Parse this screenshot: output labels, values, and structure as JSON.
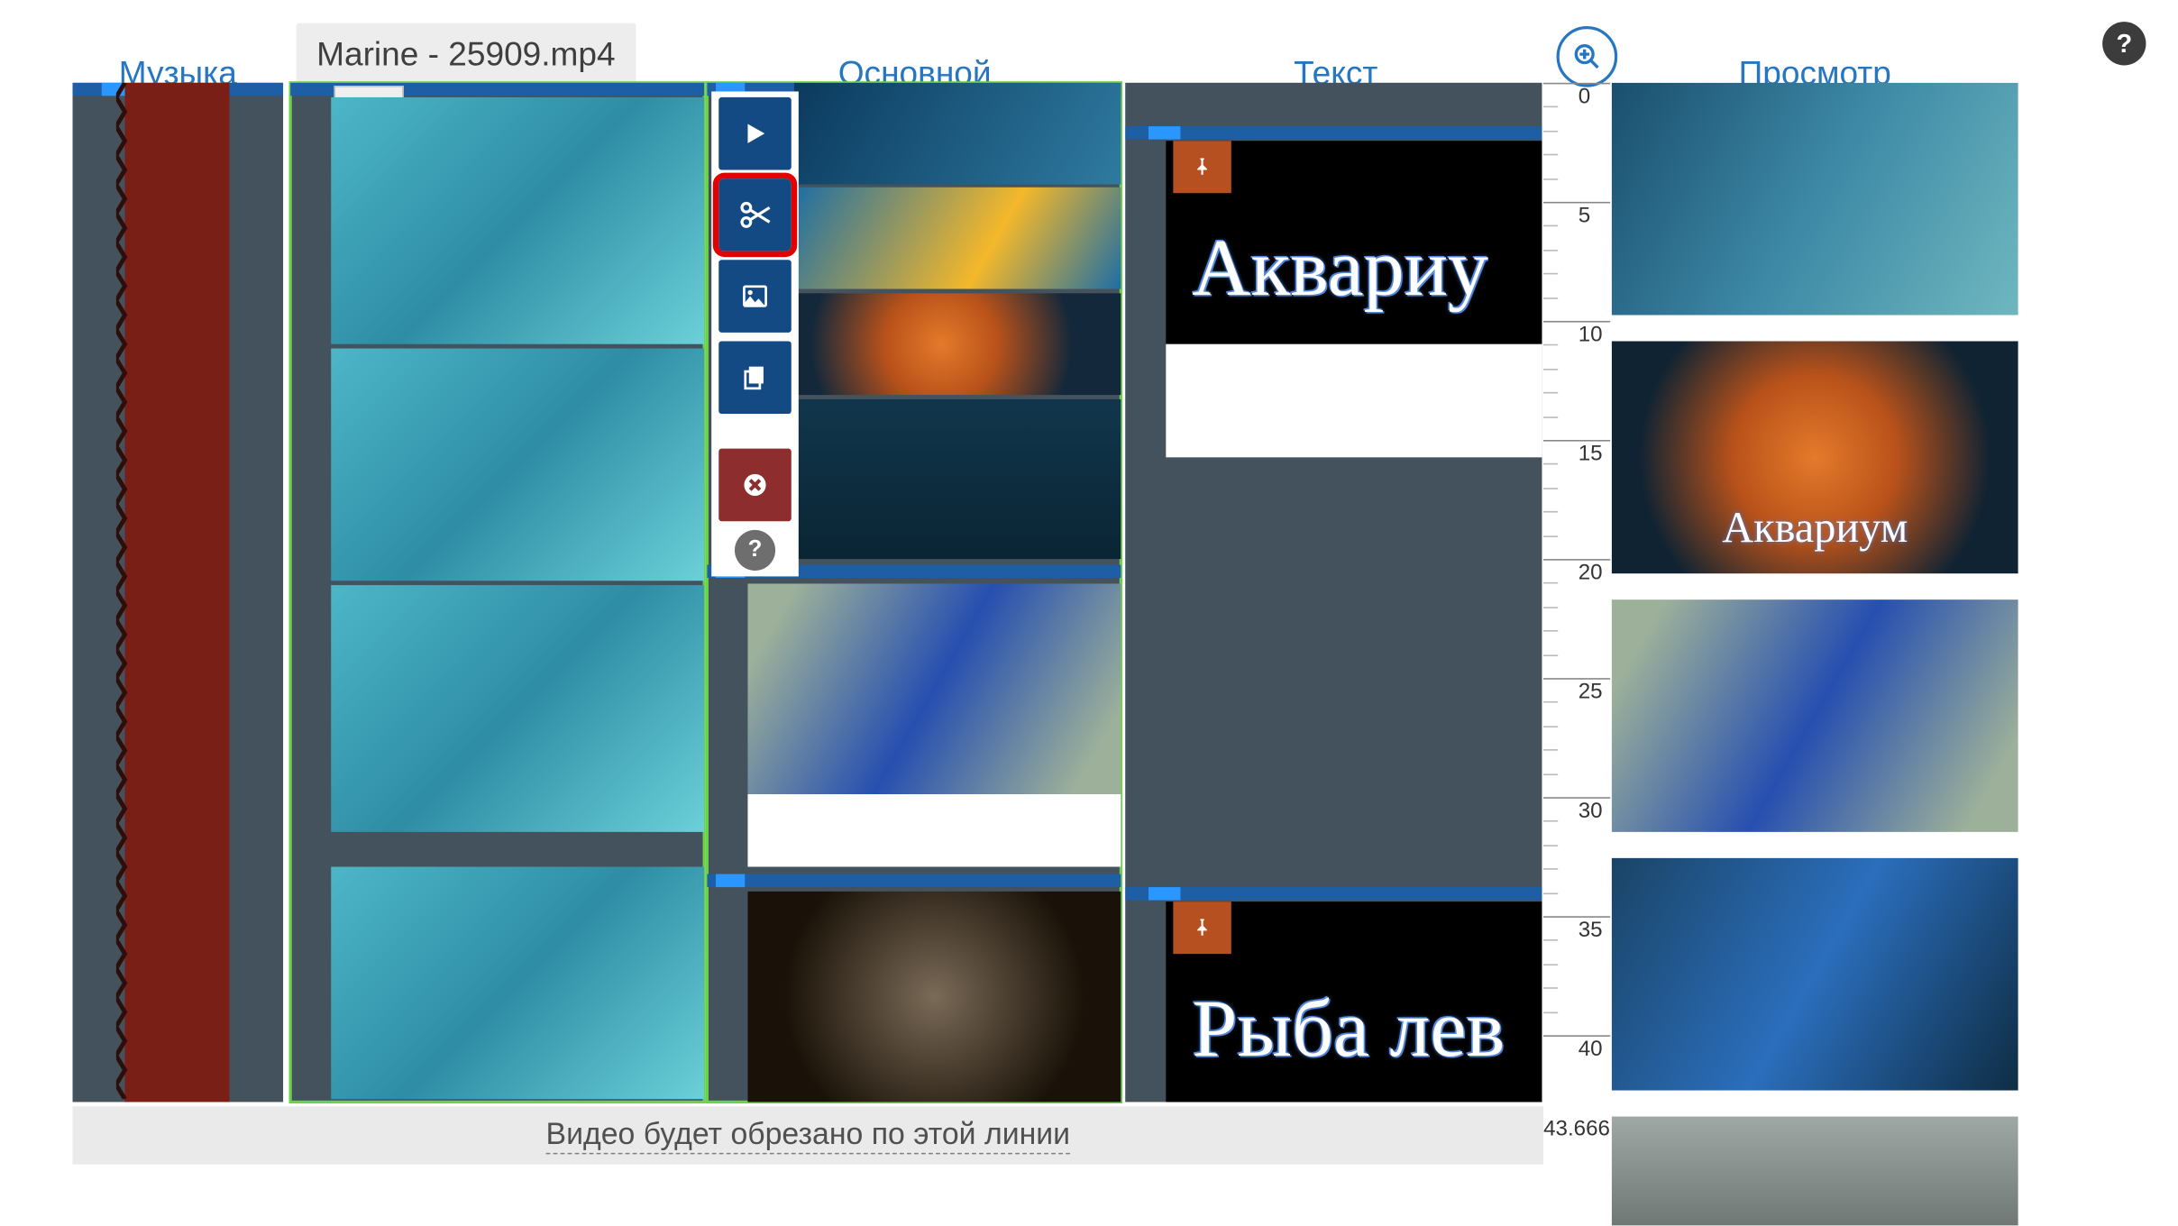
{
  "filename": "Marine - 25909.mp4",
  "tabs": {
    "music": "Музыка",
    "main": "Основной",
    "text": "Текст",
    "preview": "Просмотр"
  },
  "toolbar": {
    "play": "play",
    "cut": "cut",
    "image": "image",
    "copy": "copy",
    "delete": "delete",
    "help": "?"
  },
  "text_clips": [
    {
      "label": "Аквариу"
    },
    {
      "label": "Рыба лев"
    }
  ],
  "preview_overlay": "Аквариум",
  "ruler": {
    "ticks": [
      0,
      5,
      10,
      15,
      20,
      25,
      30,
      35,
      40
    ],
    "end_label": "43.666"
  },
  "footer": "Видео будет обрезано по этой линии",
  "help_glyph": "?"
}
